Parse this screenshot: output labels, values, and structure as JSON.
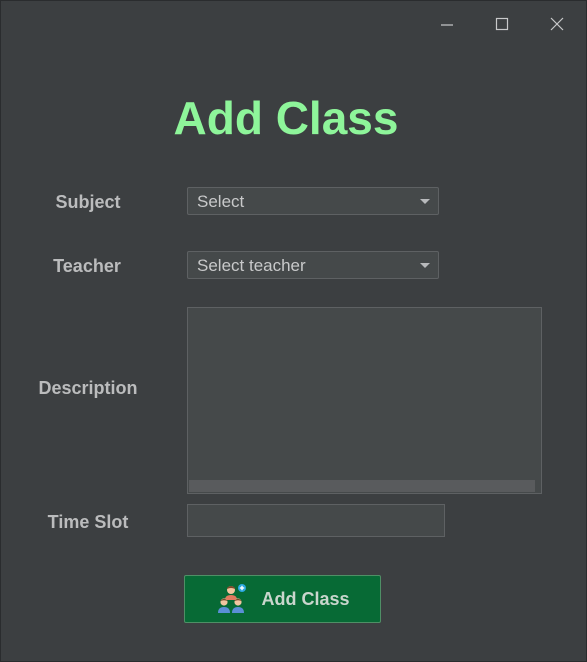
{
  "window": {
    "controls": {
      "minimize_icon": "minimize-icon",
      "maximize_icon": "maximize-icon",
      "close_icon": "close-icon"
    }
  },
  "form": {
    "title": "Add Class",
    "subject": {
      "label": "Subject",
      "selected": "Select"
    },
    "teacher": {
      "label": "Teacher",
      "selected": "Select teacher"
    },
    "description": {
      "label": "Description",
      "value": ""
    },
    "time_slot": {
      "label": "Time Slot",
      "value": ""
    },
    "submit": {
      "label": "Add Class",
      "icon": "add-group-icon"
    }
  },
  "colors": {
    "title": "#8ef59a",
    "background": "#3c3f41",
    "button": "#076a35",
    "label": "#bbbcbd"
  }
}
